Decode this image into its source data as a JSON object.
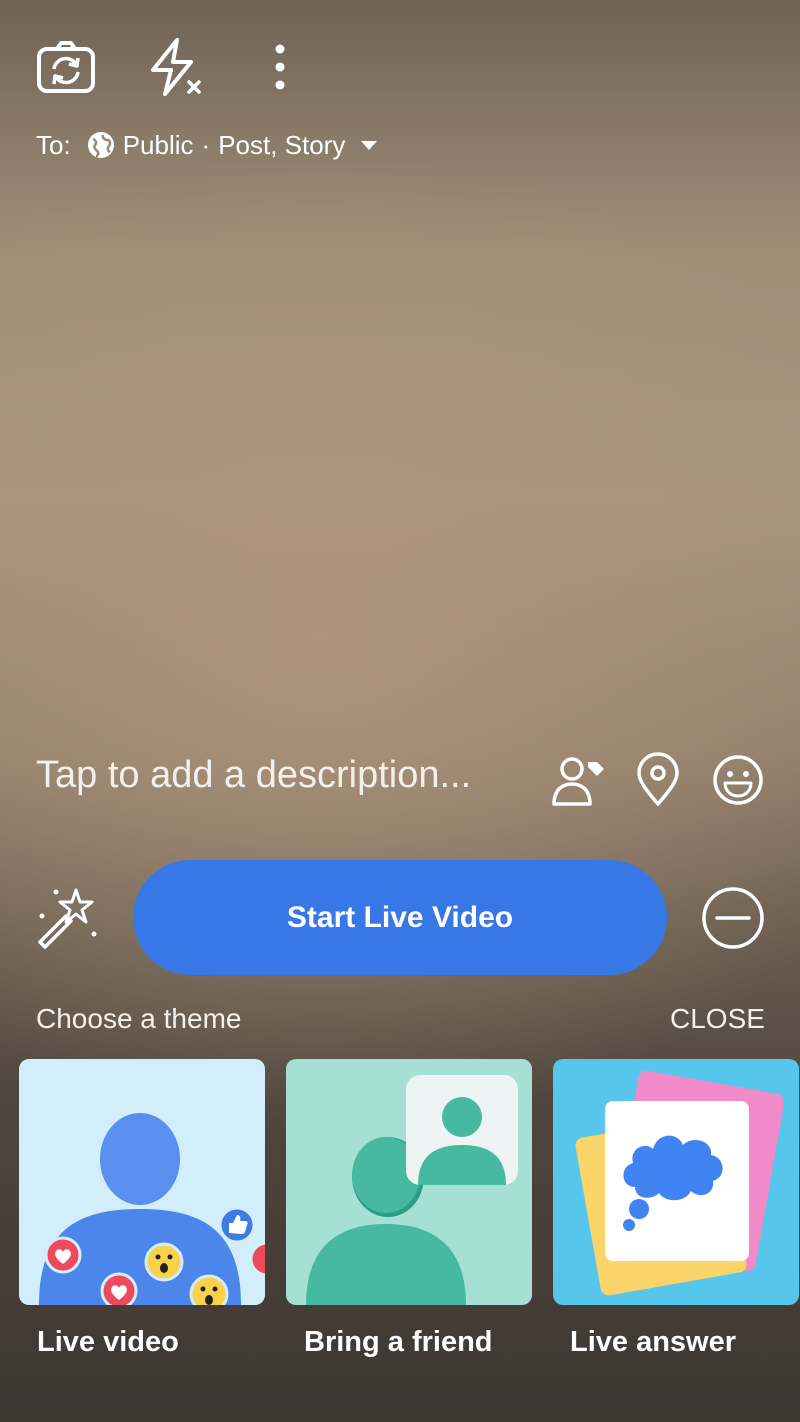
{
  "topbar": {
    "icons": [
      "flip-camera-icon",
      "flash-off-icon",
      "more-options-icon"
    ]
  },
  "audience": {
    "prefix": "To:",
    "privacy": "Public",
    "separator": "·",
    "destinations": "Post, Story"
  },
  "composer": {
    "description_placeholder": "Tap to add a description...",
    "icons": [
      "tag-people-icon",
      "location-pin-icon",
      "emoji-icon"
    ]
  },
  "controls": {
    "start_label": "Start Live Video",
    "effects_icon": "magic-wand-icon",
    "minimize_icon": "minus-circle-icon"
  },
  "themes": {
    "heading": "Choose a theme",
    "close_label": "CLOSE",
    "items": [
      {
        "label": "Live video",
        "color": "#d2eefa"
      },
      {
        "label": "Bring a friend",
        "color": "#a6e0d5"
      },
      {
        "label": "Live answer",
        "color": "#56c6ec"
      }
    ]
  },
  "colors": {
    "accent": "#3878e6",
    "text": "#ffffff"
  }
}
